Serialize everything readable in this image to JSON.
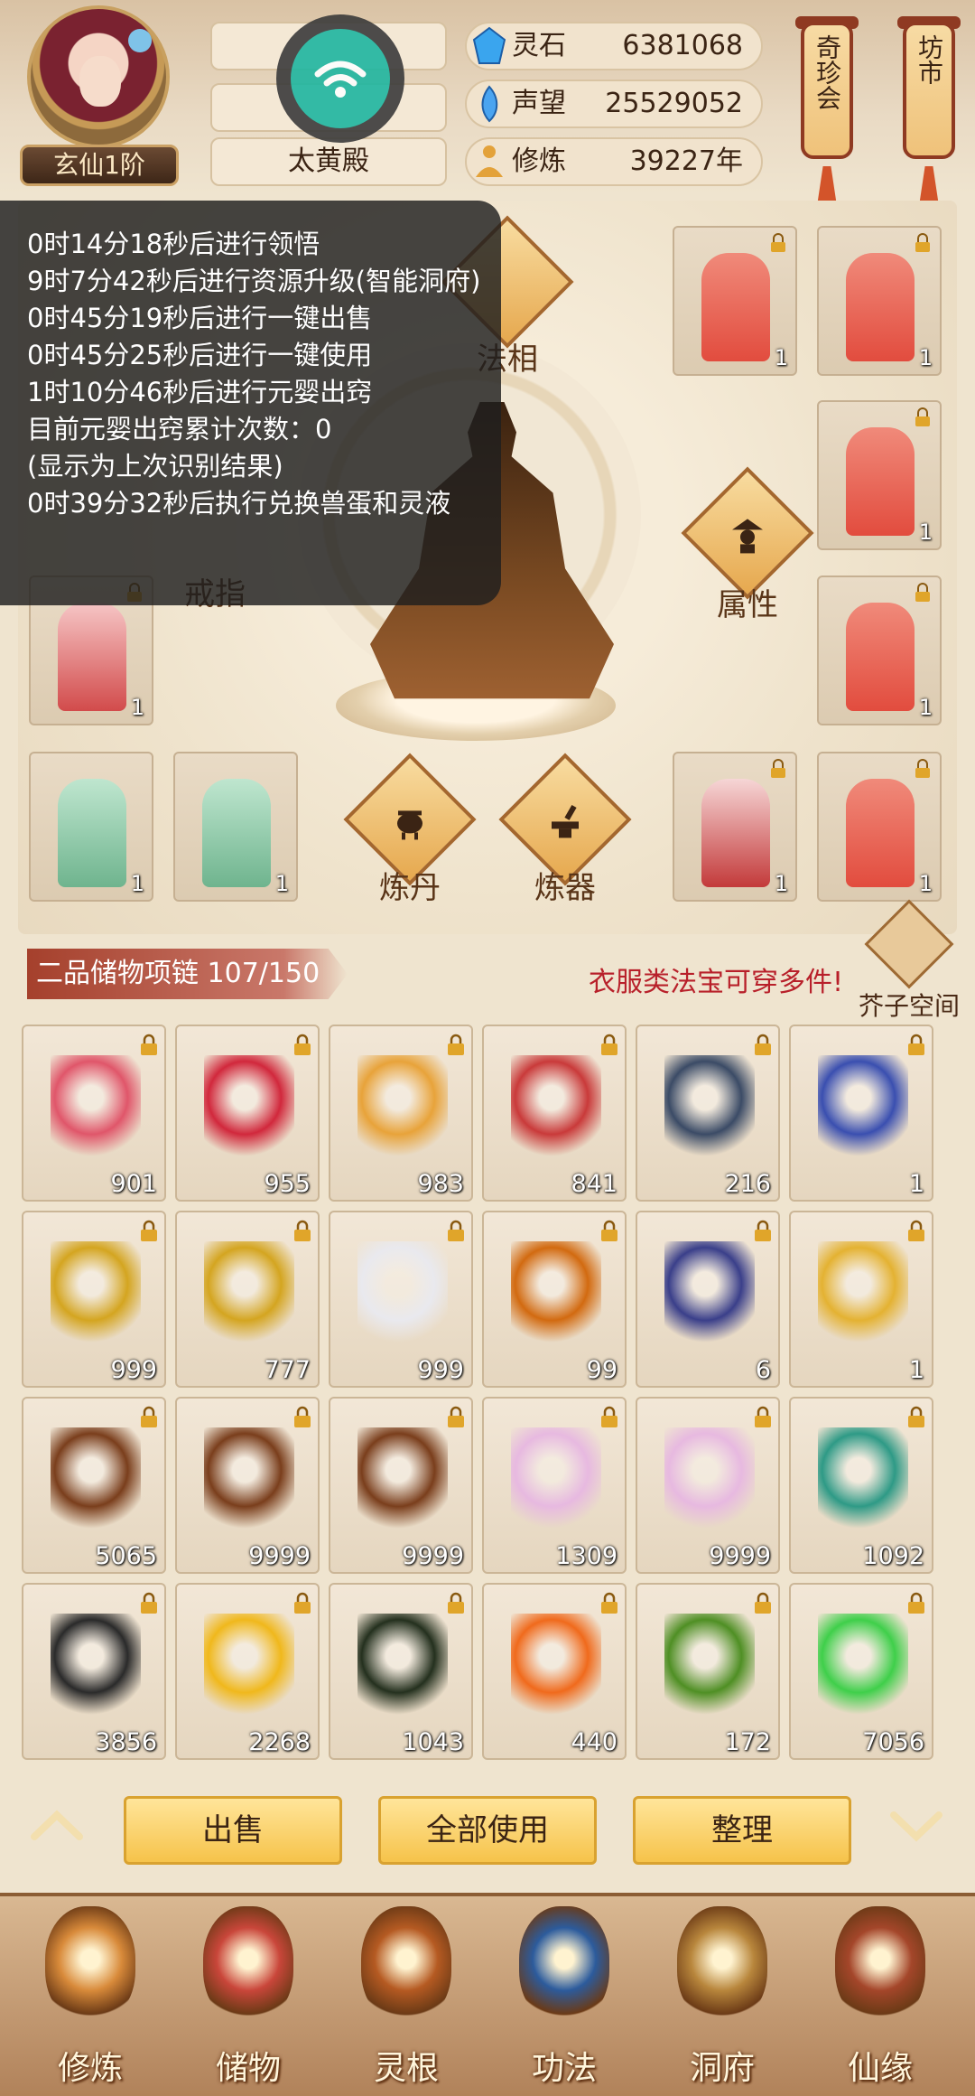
{
  "header": {
    "rank": "玄仙1阶",
    "location": "太黄殿",
    "resources": [
      {
        "label": "灵石",
        "value": "6381068",
        "icon": "spirit-stone-icon"
      },
      {
        "label": "声望",
        "value": "25529052",
        "icon": "reputation-icon"
      },
      {
        "label": "修炼",
        "value": "39227年",
        "icon": "cultivation-icon"
      }
    ],
    "lanterns": [
      {
        "label": "奇珍会"
      },
      {
        "label": "坊市"
      }
    ]
  },
  "log": {
    "lines": [
      "0时14分18秒后进行领悟",
      "9时7分42秒后进行资源升级(智能洞府)",
      "0时45分19秒后进行一键出售",
      "0时45分25秒后进行一键使用",
      "1时10分46秒后进行元婴出窍",
      "目前元婴出窍累计次数：0",
      "(显示为上次识别结果)",
      "0时39分32秒后执行兑换兽蛋和灵液"
    ]
  },
  "equip": {
    "faxiang": "法相",
    "jiezhi": "戒指",
    "shuxing": "属性",
    "liandan": "炼丹",
    "lianqi": "炼器",
    "slots": [
      {
        "qty": "1"
      },
      {
        "qty": "1"
      },
      {
        "qty": "1"
      },
      {
        "qty": "1"
      },
      {
        "qty": "1"
      },
      {
        "qty": "1"
      },
      {
        "qty": "1"
      },
      {
        "qty": "1"
      },
      {
        "qty": "1"
      }
    ]
  },
  "bag": {
    "title": "二品储物项链 107/150",
    "note": "衣服类法宝可穿多件!",
    "jiezi": "芥子空间",
    "items": [
      {
        "qty": "901",
        "color": "#e0566a"
      },
      {
        "qty": "955",
        "color": "#d1283c"
      },
      {
        "qty": "983",
        "color": "#e8a33a"
      },
      {
        "qty": "841",
        "color": "#c93a3a"
      },
      {
        "qty": "216",
        "color": "#3b4b66"
      },
      {
        "qty": "1",
        "color": "#3a4fb0"
      },
      {
        "qty": "999",
        "color": "#d4a520"
      },
      {
        "qty": "777",
        "color": "#d4a520"
      },
      {
        "qty": "999",
        "color": "#e9e9ee"
      },
      {
        "qty": "99",
        "color": "#d26a10"
      },
      {
        "qty": "6",
        "color": "#3a3f8a"
      },
      {
        "qty": "1",
        "color": "#e4b232"
      },
      {
        "qty": "5065",
        "color": "#7a3e1c"
      },
      {
        "qty": "9999",
        "color": "#7a3e1c"
      },
      {
        "qty": "9999",
        "color": "#7a3e1c"
      },
      {
        "qty": "1309",
        "color": "#e7b9e0"
      },
      {
        "qty": "9999",
        "color": "#e7b9e0"
      },
      {
        "qty": "1092",
        "color": "#2e9a86"
      },
      {
        "qty": "3856",
        "color": "#2a2a2a"
      },
      {
        "qty": "2268",
        "color": "#f0b81c"
      },
      {
        "qty": "1043",
        "color": "#24301e"
      },
      {
        "qty": "440",
        "color": "#f06a1c"
      },
      {
        "qty": "172",
        "color": "#4f8f24"
      },
      {
        "qty": "7056",
        "color": "#3fcf4a"
      }
    ]
  },
  "actions": {
    "sell": "出售",
    "use_all": "全部使用",
    "sort": "整理"
  },
  "nav": [
    {
      "label": "修炼",
      "icon": "cultivate-icon"
    },
    {
      "label": "储物",
      "icon": "storage-bag-icon"
    },
    {
      "label": "灵根",
      "icon": "spirit-root-icon"
    },
    {
      "label": "功法",
      "icon": "technique-book-icon"
    },
    {
      "label": "洞府",
      "icon": "cave-abode-icon"
    },
    {
      "label": "仙缘",
      "icon": "fate-icon"
    }
  ]
}
